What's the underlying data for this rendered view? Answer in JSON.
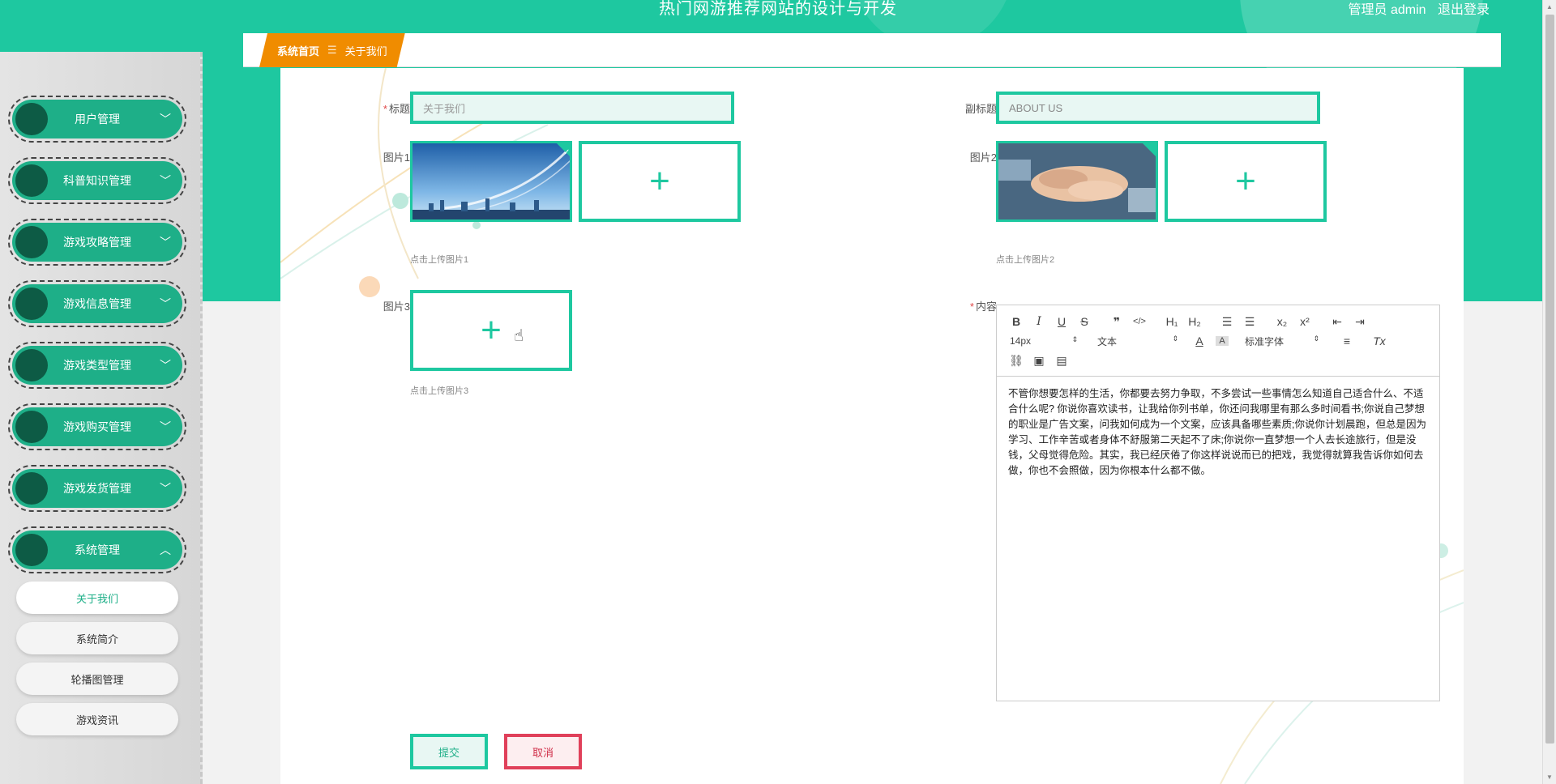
{
  "header": {
    "site_title": "热门网游推荐网站的设计与开发",
    "role": "管理员 admin",
    "logout": "退出登录"
  },
  "sidebar": {
    "menus": [
      {
        "label": "用户管理",
        "arrow": "﹀"
      },
      {
        "label": "科普知识管理",
        "arrow": "﹀"
      },
      {
        "label": "游戏攻略管理",
        "arrow": "﹀"
      },
      {
        "label": "游戏信息管理",
        "arrow": "﹀"
      },
      {
        "label": "游戏类型管理",
        "arrow": "﹀"
      },
      {
        "label": "游戏购买管理",
        "arrow": "﹀"
      },
      {
        "label": "游戏发货管理",
        "arrow": "﹀"
      },
      {
        "label": "系统管理",
        "arrow": "︿"
      }
    ],
    "submenu": [
      {
        "label": "关于我们",
        "active": true
      },
      {
        "label": "系统简介",
        "active": false
      },
      {
        "label": "轮播图管理",
        "active": false
      },
      {
        "label": "游戏资讯",
        "active": false
      }
    ]
  },
  "breadcrumb": {
    "home": "系统首页",
    "separator": "☰",
    "current": "关于我们"
  },
  "form": {
    "title_label": "标题",
    "title_placeholder": "关于我们",
    "subtitle_label": "副标题",
    "subtitle_value": "ABOUT US",
    "pic1_label": "图片1",
    "pic1_tip": "点击上传图片1",
    "pic2_label": "图片2",
    "pic2_tip": "点击上传图片2",
    "pic3_label": "图片3",
    "pic3_tip": "点击上传图片3",
    "content_label": "内容",
    "required_mark": "*",
    "upload_plus": "+",
    "submit": "提交",
    "cancel": "取消"
  },
  "editor": {
    "font_size": "14px",
    "block_type": "文本",
    "font_family": "标准字体",
    "content": "不管你想要怎样的生活，你都要去努力争取，不多尝试一些事情怎么知道自己适合什么、不适合什么呢? 你说你喜欢读书，让我给你列书单，你还问我哪里有那么多时间看书;你说自己梦想的职业是广告文案，问我如何成为一个文案，应该具备哪些素质;你说你计划晨跑，但总是因为学习、工作辛苦或者身体不舒服第二天起不了床;你说你一直梦想一个人去长途旅行，但是没钱，父母觉得危险。其实，我已经厌倦了你这样说说而已的把戏，我觉得就算我告诉你如何去做，你也不会照做，因为你根本什么都不做。"
  },
  "colors": {
    "accent": "#1ec8a0",
    "menu": "#1eaf88",
    "crumb": "#f08c00",
    "cancel": "#e0405a"
  }
}
